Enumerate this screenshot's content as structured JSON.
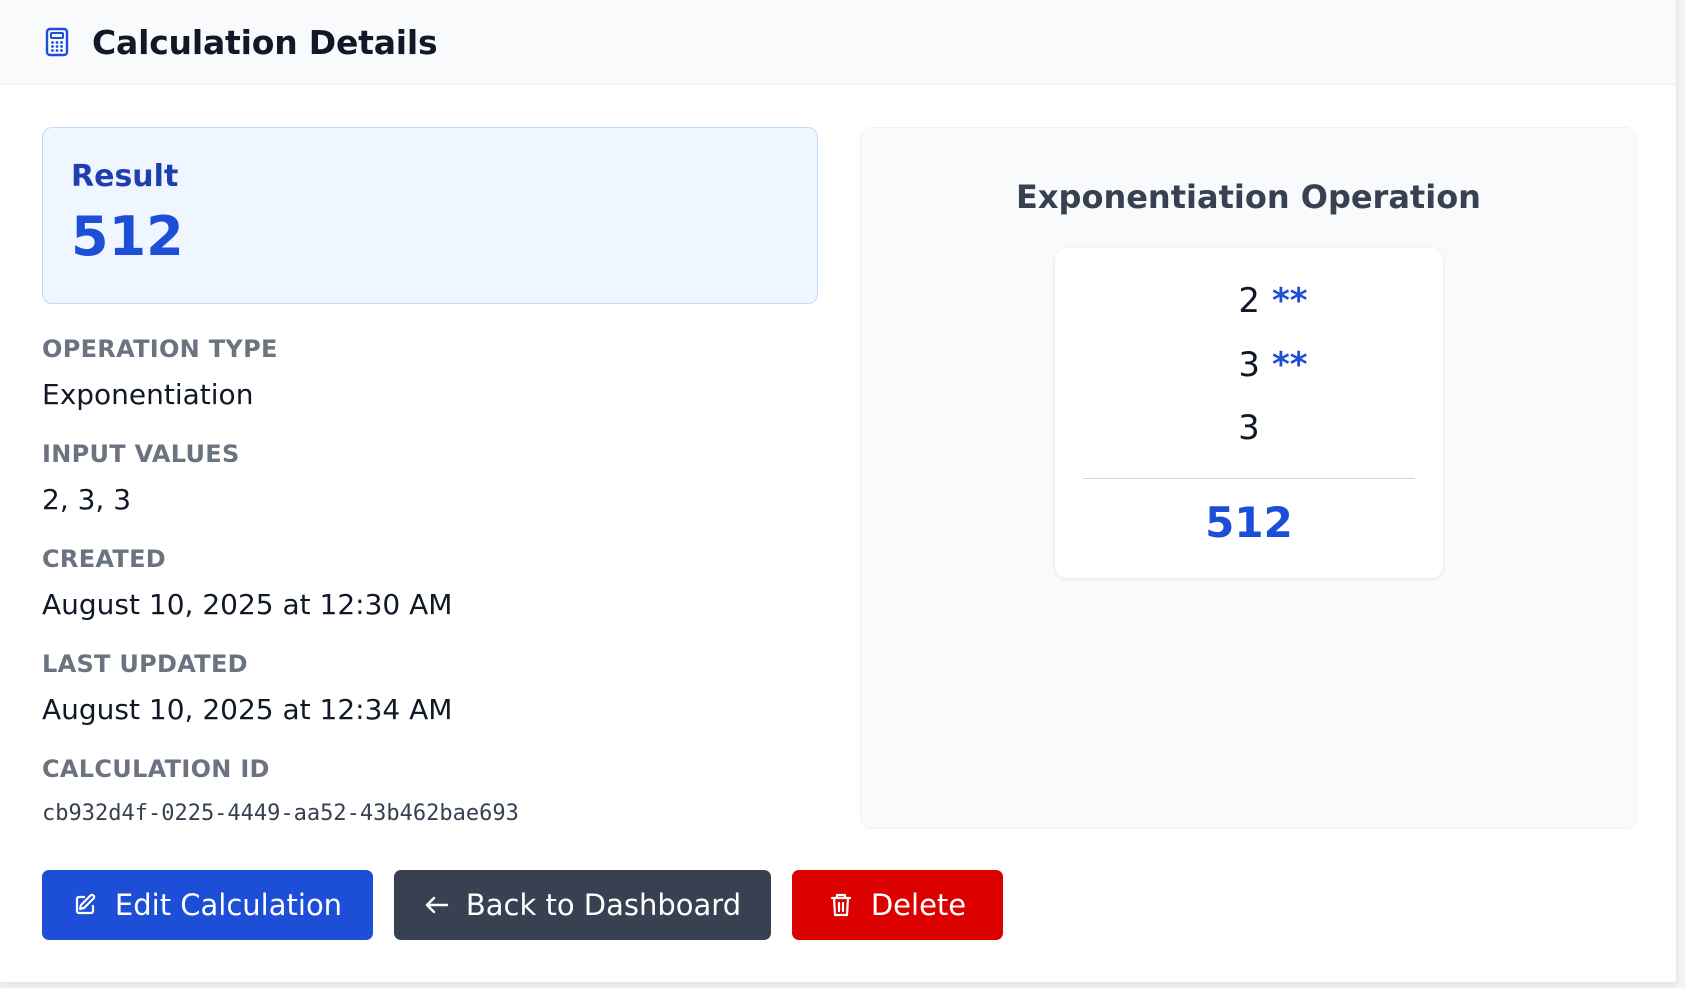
{
  "header": {
    "title": "Calculation Details",
    "icon": "calculator-icon"
  },
  "result": {
    "label": "Result",
    "value": "512"
  },
  "fields": {
    "operation_type": {
      "label": "OPERATION TYPE",
      "value": "Exponentiation"
    },
    "input_values": {
      "label": "INPUT VALUES",
      "value": "2, 3, 3"
    },
    "created": {
      "label": "CREATED",
      "value": "August 10, 2025 at 12:30 AM"
    },
    "last_updated": {
      "label": "LAST UPDATED",
      "value": "August 10, 2025 at 12:34 AM"
    },
    "calculation_id": {
      "label": "CALCULATION ID",
      "value": "cb932d4f-0225-4449-aa52-43b462bae693"
    }
  },
  "operation": {
    "title": "Exponentiation Operation",
    "rows": [
      {
        "value": "2",
        "operator": "**"
      },
      {
        "value": "3",
        "operator": "**"
      },
      {
        "value": "3"
      }
    ],
    "result": "512"
  },
  "actions": {
    "edit": {
      "label": "Edit Calculation",
      "icon": "edit-icon"
    },
    "back": {
      "label": "Back to Dashboard",
      "icon": "arrow-left-icon"
    },
    "delete": {
      "label": "Delete",
      "icon": "trash-icon"
    }
  },
  "colors": {
    "primary": "#1d4ed8",
    "dark": "#374151",
    "danger": "#dc0000",
    "result_bg": "#eff6ff"
  }
}
